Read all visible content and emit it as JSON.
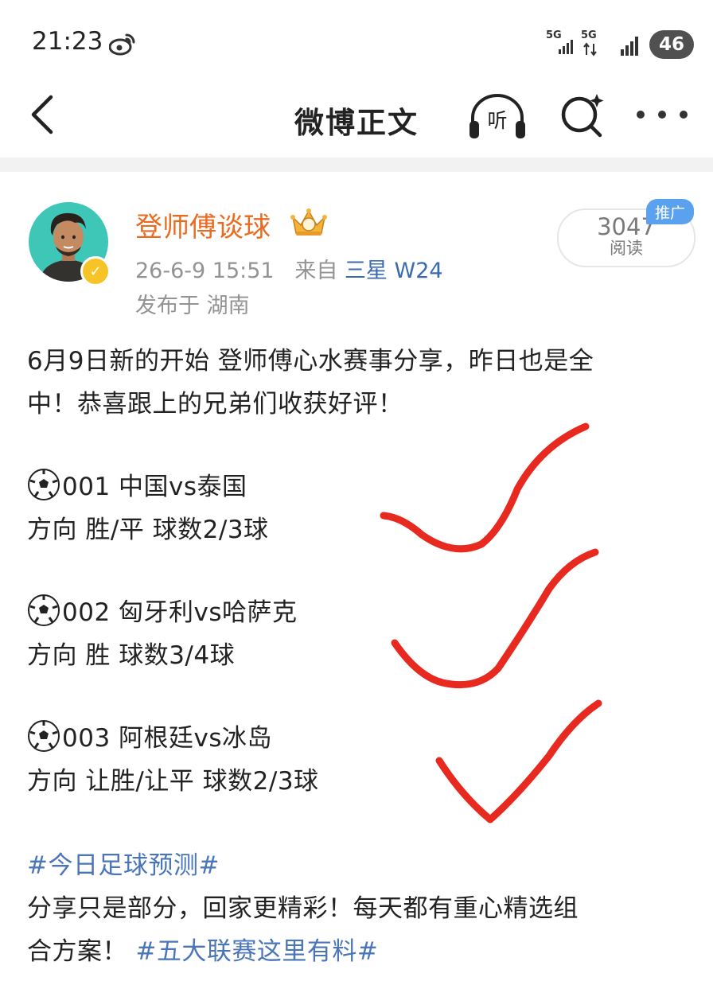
{
  "status_bar": {
    "time": "21:23",
    "net1": "5G",
    "net2": "5G",
    "battery": "46"
  },
  "nav": {
    "title": "微博正文",
    "listen_glyph": "听"
  },
  "post": {
    "author": "登师傅谈球",
    "timestamp": "26-6-9 15:51",
    "source_prefix": "来自",
    "source": "三星 W24",
    "location": "发布于 湖南",
    "reads": "3047",
    "reads_label": "阅读",
    "promo": "推广",
    "lines": {
      "intro1": "6月9日新的开始 登师傅心水赛事分享，昨日也是全",
      "intro2": "中！恭喜跟上的兄弟们收获好评！",
      "m1_title": "001 中国vs泰国",
      "m1_detail": "方向 胜/平 球数2/3球",
      "m2_title": "002 匈牙利vs哈萨克",
      "m2_detail": "方向 胜 球数3/4球",
      "m3_title": "003 阿根廷vs冰岛",
      "m3_detail": "方向 让胜/让平 球数2/3球",
      "tag1": "#今日足球预测#",
      "outro1": "分享只是部分，回家更精彩！每天都有重心精选组",
      "outro2": "合方案！",
      "tag2": "#五大联赛这里有料#"
    }
  },
  "colors": {
    "username": "#ea6a1f",
    "link": "#4a75b8",
    "check": "#e8291f",
    "promo": "#5aa2f0"
  }
}
